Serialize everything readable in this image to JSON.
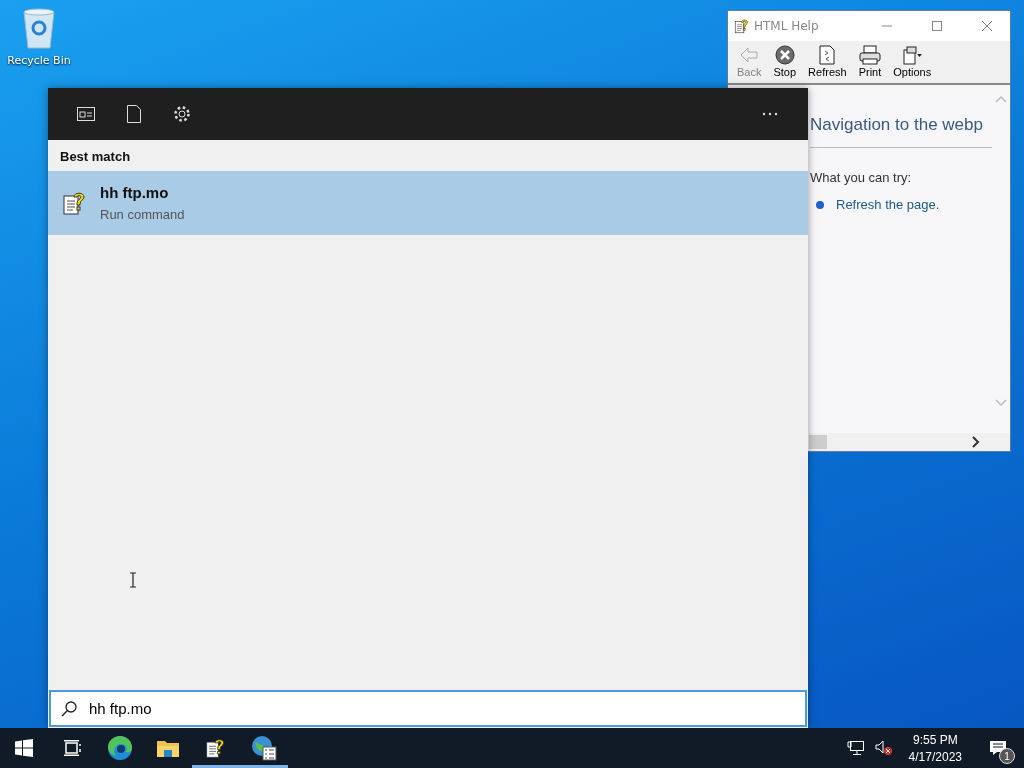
{
  "desktop": {
    "icons": [
      {
        "label": "Recycle Bin"
      }
    ]
  },
  "help_window": {
    "title": "HTML Help",
    "toolbar": [
      {
        "kind": "back",
        "label": "Back",
        "disabled": true
      },
      {
        "kind": "stop",
        "label": "Stop",
        "disabled": false
      },
      {
        "kind": "refresh",
        "label": "Refresh",
        "disabled": false
      },
      {
        "kind": "print",
        "label": "Print",
        "disabled": false
      },
      {
        "kind": "options",
        "label": "Options",
        "disabled": false
      }
    ],
    "content": {
      "heading": "Navigation to the webp",
      "subheading": "What you can try:",
      "links": [
        "Refresh the page."
      ]
    }
  },
  "search": {
    "section": "Best match",
    "results": [
      {
        "title": "hh ftp.mo",
        "subtitle": "Run command",
        "selected": true
      }
    ],
    "query": "hh ftp.mo"
  },
  "taskbar": {
    "apps": [
      {
        "kind": "start",
        "running": false
      },
      {
        "kind": "task-view",
        "running": false
      },
      {
        "kind": "edge",
        "running": false
      },
      {
        "kind": "explorer",
        "running": false
      },
      {
        "kind": "help",
        "running": true
      },
      {
        "kind": "ie-setup",
        "running": true
      }
    ],
    "clock": {
      "time": "9:55 PM",
      "date": "4/17/2023"
    },
    "notification_count": "1"
  }
}
